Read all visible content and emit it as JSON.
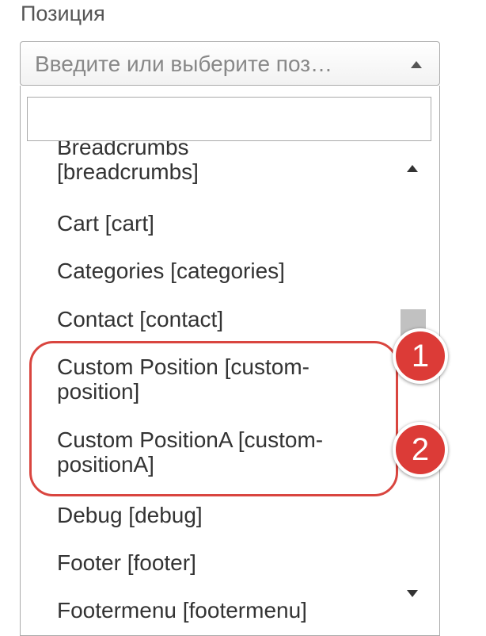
{
  "field": {
    "label": "Позиция"
  },
  "select": {
    "placeholder": "Введите или выберите поз…"
  },
  "search": {
    "value": ""
  },
  "options": [
    {
      "line1": "Breadcrumbs",
      "line2": "[breadcrumbs]"
    },
    {
      "line1": "Cart [cart]",
      "line2": ""
    },
    {
      "line1": "Categories [categories]",
      "line2": ""
    },
    {
      "line1": "Contact [contact]",
      "line2": ""
    },
    {
      "line1": "Custom Position [custom-",
      "line2": "position]"
    },
    {
      "line1": "Custom PositionA [custom-",
      "line2": "positionA]"
    },
    {
      "line1": "Debug [debug]",
      "line2": ""
    },
    {
      "line1": "Footer [footer]",
      "line2": ""
    },
    {
      "line1": "Footermenu [footermenu]",
      "line2": ""
    }
  ],
  "annotations": {
    "marker1": "1",
    "marker2": "2"
  },
  "colors": {
    "accent_red": "#d9453f",
    "marker_red": "#dc3b37",
    "scroll_thumb": "#c1c1c1"
  },
  "icons": {
    "search": "search-icon",
    "dropdown_arrow": "caret-up-icon"
  }
}
